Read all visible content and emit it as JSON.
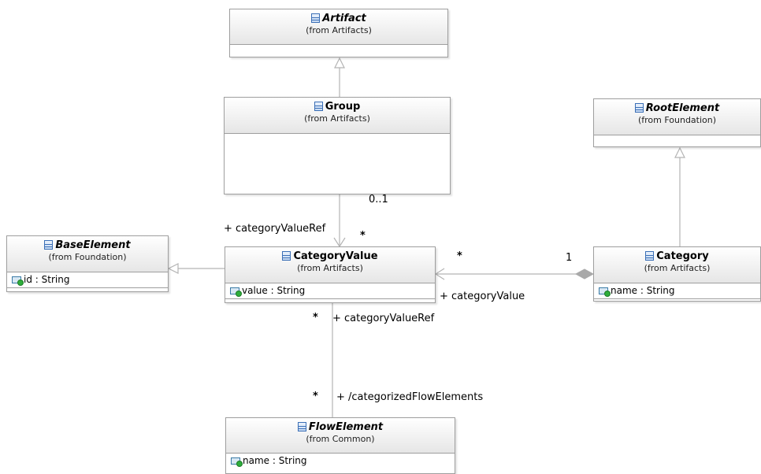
{
  "classes": {
    "artifact": {
      "name": "Artifact",
      "from": "(from Artifacts)"
    },
    "group": {
      "name": "Group",
      "from": "(from Artifacts)"
    },
    "root_element": {
      "name": "RootElement",
      "from": "(from Foundation)"
    },
    "base_element": {
      "name": "BaseElement",
      "from": "(from Foundation)",
      "attribute": "id : String"
    },
    "category_value": {
      "name": "CategoryValue",
      "from": "(from Artifacts)",
      "attribute": "value : String"
    },
    "category": {
      "name": "Category",
      "from": "(from Artifacts)",
      "attribute": "name : String"
    },
    "flow_element": {
      "name": "FlowElement",
      "from": "(from Common)",
      "attribute": "name : String"
    }
  },
  "associations": {
    "group_to_category_value": {
      "source_multiplicity": "0..1",
      "target_role": "+ categoryValueRef",
      "target_multiplicity": "*"
    },
    "category_to_category_value": {
      "source_multiplicity": "1",
      "target_role": "+ categoryValue",
      "target_multiplicity": "*"
    },
    "category_value_to_flow_element": {
      "upper_multiplicity": "*",
      "upper_role": "+ categoryValueRef",
      "lower_multiplicity": "*",
      "lower_role": "+ /categorizedFlowElements"
    }
  },
  "colors": {
    "line": "#b4b4b4",
    "border": "#9e9e9e",
    "header_gradient_end": "#e6e6e6",
    "class_icon": "#3b6fb6",
    "attribute_icon_dot": "#2eae3b"
  }
}
